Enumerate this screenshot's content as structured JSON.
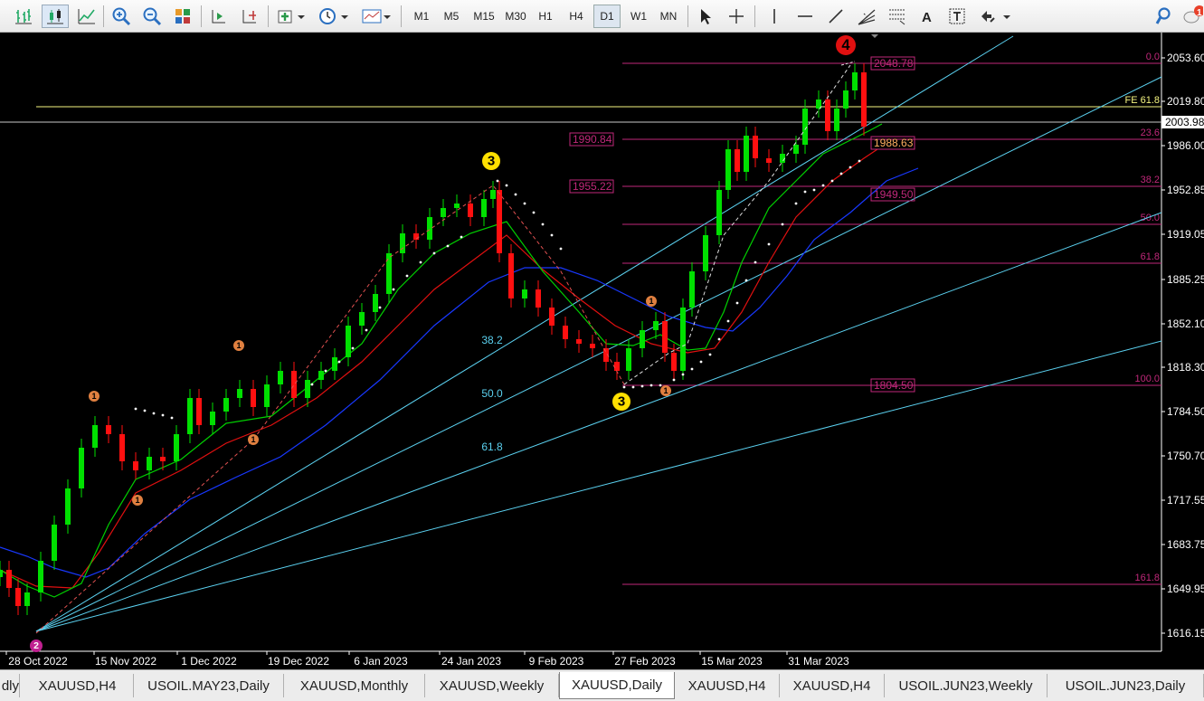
{
  "toolbar": {
    "timeframes": [
      "M1",
      "M5",
      "M15",
      "M30",
      "H1",
      "H4",
      "D1",
      "W1",
      "MN"
    ],
    "active_timeframe": "D1",
    "notification_badge": "1",
    "tools": [
      "bar-chart-icon",
      "candlestick-icon",
      "line-chart-icon",
      "zoom-in-icon",
      "zoom-out-icon",
      "tile-windows-icon",
      "autoscroll-icon",
      "chart-shift-icon",
      "indicators-icon",
      "periodicity-clock-icon",
      "templates-icon",
      "cursor-icon",
      "crosshair-icon",
      "vertical-line-icon",
      "horizontal-line-icon",
      "trendline-icon",
      "fibonacci-fan-icon",
      "fibonacci-retracement-icon",
      "text-icon",
      "text-label-icon",
      "arrows-icon",
      "search-icon",
      "notification-icon"
    ]
  },
  "chart": {
    "symbol": "XAUUSD",
    "timeframe": "Daily",
    "current_price": "2003.98",
    "price_axis": [
      "2053.60",
      "2019.80",
      "1986.00",
      "1952.85",
      "1919.05",
      "1885.25",
      "1852.10",
      "1818.30",
      "1784.50",
      "1750.70",
      "1717.55",
      "1683.75",
      "1649.95",
      "1616.15"
    ],
    "date_axis": [
      "28 Oct 2022",
      "15 Nov 2022",
      "1 Dec 2022",
      "19 Dec 2022",
      "6 Jan 2023",
      "24 Jan 2023",
      "9 Feb 2023",
      "27 Feb 2023",
      "15 Mar 2023",
      "31 Mar 2023"
    ],
    "fib_levels": [
      "0.0",
      "FE 61.8",
      "23.6",
      "38.2",
      "50.0",
      "61.8",
      "100.0",
      "161.8"
    ],
    "fan_labels": [
      "38.2",
      "50.0",
      "61.8"
    ],
    "price_boxes": [
      "1990.84",
      "1955.22",
      "2048.78",
      "1988.63",
      "1949.50",
      "1804.50"
    ],
    "wave_labels": [
      "2",
      "3",
      "3",
      "4"
    ],
    "minor_labels": [
      "1",
      "1",
      "1",
      "1",
      "1",
      "1"
    ],
    "colors": {
      "bull": "#00e000",
      "bear": "#ff1010",
      "fib": "#c0287a",
      "fan": "#5bd1f0",
      "ma_fast": "#00d000",
      "ma_mid": "#e01010",
      "ma_slow": "#1838ff",
      "fe": "#f5f580"
    }
  },
  "tabs": {
    "items": [
      "dly",
      "XAUUSD,H4",
      "USOIL.MAY23,Daily",
      "XAUUSD,Monthly",
      "XAUUSD,Weekly",
      "XAUUSD,Daily",
      "XAUUSD,H4",
      "XAUUSD,H4",
      "USOIL.JUN23,Weekly",
      "USOIL.JUN23,Daily"
    ],
    "active_index": 5
  }
}
